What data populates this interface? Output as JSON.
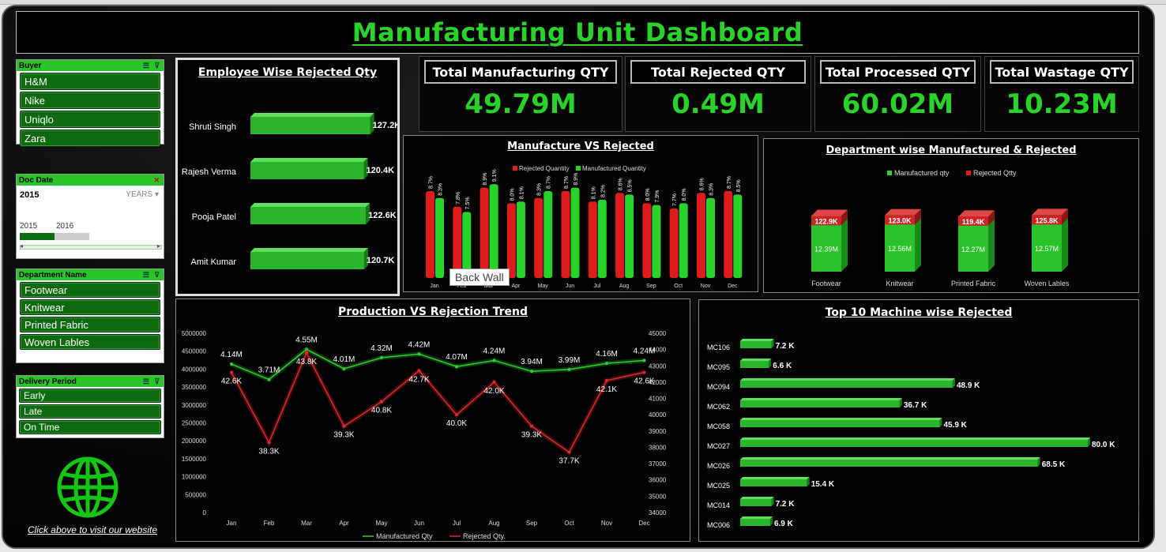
{
  "title": "Manufacturing Unit Dashboard",
  "slicers": {
    "buyer": {
      "title": "Buyer",
      "items": [
        "H&M",
        "Nike",
        "Uniqlo",
        "Zara"
      ]
    },
    "doc_date": {
      "title": "Doc Date",
      "selected": "2015",
      "granularity": "YEARS",
      "years": [
        "2015",
        "2016"
      ]
    },
    "department": {
      "title": "Department Name",
      "items": [
        "Footwear",
        "Knitwear",
        "Printed Fabric",
        "Woven Lables"
      ]
    },
    "delivery": {
      "title": "Delivery Period",
      "items": [
        "Early",
        "Late",
        "On Time"
      ]
    }
  },
  "website_link": "Click above to visit our website",
  "kpis": [
    {
      "label": "Total Manufacturing QTY",
      "value": "49.79M"
    },
    {
      "label": "Total Rejected QTY",
      "value": "0.49M"
    },
    {
      "label": "Total Processed QTY",
      "value": "60.02M"
    },
    {
      "label": "Total Wastage QTY",
      "value": "10.23M"
    }
  ],
  "tooltip": "Back Wall",
  "colors": {
    "green": "#29d42a",
    "red": "#e01b1b",
    "dark_green": "#0e6a0e"
  },
  "chart_data": [
    {
      "id": "employee",
      "type": "bar",
      "title": "Employee Wise Rejected Qty",
      "categories": [
        "Shruti Singh",
        "Rajesh Verma",
        "Pooja Patel",
        "Amit Kumar"
      ],
      "values": [
        127.2,
        120.4,
        122.6,
        120.7
      ],
      "labels": [
        "127.2K",
        "120.4K",
        "122.6K",
        "120.7K"
      ],
      "xlim": [
        0,
        130
      ]
    },
    {
      "id": "mvr",
      "type": "bar",
      "title": "Manufacture VS Rejected",
      "categories": [
        "Jan",
        "Feb",
        "Mar",
        "Apr",
        "May",
        "Jun",
        "Jul",
        "Aug",
        "Sep",
        "Oct",
        "Nov",
        "Dec"
      ],
      "series": [
        {
          "name": "Rejected Quantity",
          "values": [
            8.7,
            7.8,
            8.9,
            8.0,
            8.3,
            8.7,
            8.1,
            8.6,
            8.0,
            7.7,
            8.6,
            8.7
          ],
          "labels": [
            "8.7%",
            "7.8%",
            "8.9%",
            "8.0%",
            "8.3%",
            "8.7%",
            "8.1%",
            "8.6%",
            "8.0%",
            "7.7%",
            "8.6%",
            "8.7%"
          ]
        },
        {
          "name": "Manufactured Quantity",
          "values": [
            8.3,
            7.5,
            9.1,
            8.1,
            8.7,
            8.9,
            8.2,
            8.5,
            7.9,
            8.0,
            8.3,
            8.5
          ],
          "labels": [
            "8.3%",
            "7.5%",
            "9.1%",
            "8.1%",
            "8.7%",
            "8.9%",
            "8.2%",
            "8.5%",
            "7.9%",
            "8.0%",
            "8.3%",
            "8.5%"
          ]
        }
      ]
    },
    {
      "id": "dept",
      "type": "bar",
      "stacked": true,
      "title": "Department wise Manufactured & Rejected",
      "categories": [
        "Footwear",
        "Knitwear",
        "Printed Fabric",
        "Woven Lables"
      ],
      "series": [
        {
          "name": "Manufactured qty",
          "values": [
            12.39,
            12.56,
            12.27,
            12.57
          ],
          "labels": [
            "12.39M",
            "12.56M",
            "12.27M",
            "12.57M"
          ]
        },
        {
          "name": "Rejected Qtty",
          "values": [
            122.9,
            123.0,
            119.4,
            125.8
          ],
          "labels": [
            "122.9K",
            "123.0K",
            "119.4K",
            "125.8K"
          ]
        }
      ]
    },
    {
      "id": "trend",
      "type": "line",
      "title": "Production VS Rejection Trend",
      "categories": [
        "Jan",
        "Feb",
        "Mar",
        "Apr",
        "May",
        "Jun",
        "Jul",
        "Aug",
        "Sep",
        "Oct",
        "Nov",
        "Dec"
      ],
      "left_ticks": [
        "5000000",
        "4500000",
        "4000000",
        "3500000",
        "3000000",
        "2500000",
        "2000000",
        "1500000",
        "1000000",
        "500000",
        "0"
      ],
      "right_ticks": [
        "45000",
        "44000",
        "43000",
        "42000",
        "41000",
        "40000",
        "39000",
        "38000",
        "37000",
        "36000",
        "35000",
        "34000"
      ],
      "ylim_left": [
        0,
        5000000
      ],
      "ylim_right": [
        34000,
        45000
      ],
      "series": [
        {
          "name": "Manufactured Qty",
          "axis": "left",
          "values": [
            4140000,
            3710000,
            4550000,
            4010000,
            4320000,
            4420000,
            4070000,
            4240000,
            3940000,
            3990000,
            4160000,
            4240000
          ],
          "labels": [
            "4.14M",
            "3.71M",
            "4.55M",
            "4.01M",
            "4.32M",
            "4.42M",
            "4.07M",
            "4.24M",
            "3.94M",
            "3.99M",
            "4.16M",
            "4.24M"
          ]
        },
        {
          "name": "Rejected Qty.",
          "axis": "right",
          "values": [
            42600,
            38300,
            43800,
            39300,
            40800,
            42700,
            40000,
            42000,
            39300,
            37700,
            42100,
            42600
          ],
          "labels": [
            "42.6K",
            "38.3K",
            "43.8K",
            "39.3K",
            "40.8K",
            "42.7K",
            "40.0K",
            "42.0K",
            "39.3K",
            "37.7K",
            "42.1K",
            "42.6K"
          ]
        }
      ]
    },
    {
      "id": "machine",
      "type": "bar",
      "title": "Top 10 Machine wise Rejected",
      "categories": [
        "MC106",
        "MC095",
        "MC094",
        "MC062",
        "MC058",
        "MC027",
        "MC026",
        "MC025",
        "MC014",
        "MC006"
      ],
      "values": [
        7.2,
        6.6,
        48.9,
        36.7,
        45.9,
        80.0,
        68.5,
        15.4,
        7.2,
        6.9
      ],
      "labels": [
        "7.2 K",
        "6.6 K",
        "48.9 K",
        "36.7 K",
        "45.9 K",
        "80.0 K",
        "68.5 K",
        "15.4 K",
        "7.2 K",
        "6.9 K"
      ],
      "xlim": [
        0,
        80
      ]
    }
  ]
}
